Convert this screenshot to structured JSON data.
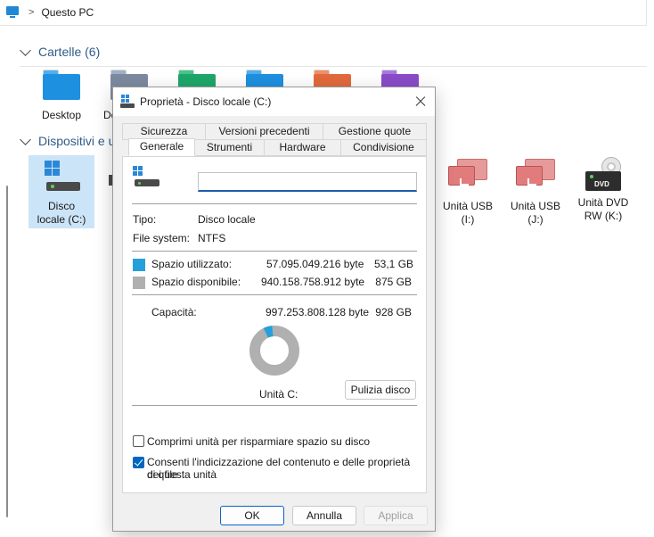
{
  "explorer": {
    "breadcrumb": "Questo PC",
    "groups": {
      "folders_header": "Cartelle (6)",
      "devices_header": "Dispositivi e u"
    },
    "folders": [
      {
        "label": "Desktop",
        "color": "#1e90e0"
      },
      {
        "label": "Do",
        "color": "#7c8aa0"
      },
      {
        "label": "",
        "color": "#1ea76a"
      },
      {
        "label": "",
        "color": "#1e90e0"
      },
      {
        "label": "",
        "color": "#e26a3c"
      },
      {
        "label": "",
        "color": "#8a4cc9"
      }
    ],
    "drives": {
      "local_c": {
        "line1": "Disco",
        "line2": "locale (C:)"
      },
      "usb_i": {
        "line1": "Unità USB",
        "line2": "(I:)"
      },
      "usb_j": {
        "line1": "Unità USB",
        "line2": "(J:)"
      },
      "dvd_k": {
        "line1": "Unità DVD",
        "line2": "RW (K:)",
        "badge": "DVD"
      }
    }
  },
  "dialog": {
    "title": "Proprietà - Disco locale (C:)",
    "tabs_row1": [
      "Sicurezza",
      "Versioni precedenti",
      "Gestione quote"
    ],
    "tabs_row2": [
      "Generale",
      "Strumenti",
      "Hardware",
      "Condivisione"
    ],
    "active_tab": "Generale",
    "name_value": "",
    "type_label": "Tipo:",
    "type_value": "Disco locale",
    "fs_label": "File system:",
    "fs_value": "NTFS",
    "used": {
      "label": "Spazio utilizzato:",
      "bytes": "57.095.049.216 byte",
      "size": "53,1 GB",
      "color": "#26a0da",
      "fraction": 0.0573
    },
    "free": {
      "label": "Spazio disponibile:",
      "bytes": "940.158.758.912 byte",
      "size": "875 GB",
      "color": "#b0b0b0"
    },
    "capacity": {
      "label": "Capacità:",
      "bytes": "997.253.808.128 byte",
      "size": "928 GB"
    },
    "drive_label": "Unità C:",
    "cleanup_button": "Pulizia disco",
    "compress_checkbox": {
      "label": "Comprimi unità per risparmiare spazio su disco",
      "checked": false
    },
    "index_checkbox": {
      "label_line1": "Consenti l'indicizzazione del contenuto e delle proprietà dei file",
      "label_line2": "di questa unità",
      "checked": true
    },
    "buttons": {
      "ok": "OK",
      "cancel": "Annulla",
      "apply": "Applica"
    }
  }
}
